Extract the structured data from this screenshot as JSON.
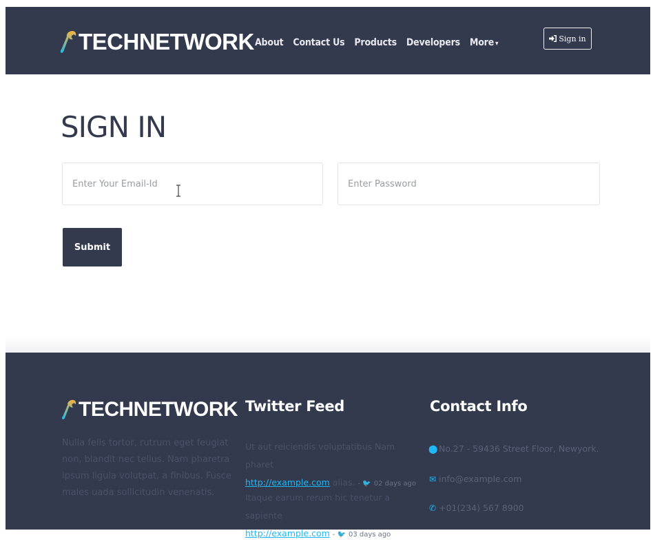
{
  "header": {
    "brand": "TECHNETWORK",
    "nav": [
      {
        "label": "About"
      },
      {
        "label": "Contact Us"
      },
      {
        "label": "Products"
      },
      {
        "label": "Developers"
      },
      {
        "label": "More"
      }
    ],
    "signin_label": "Sign in",
    "signin_icon": "sign-in-icon"
  },
  "main": {
    "title": "SIGN IN",
    "email_placeholder": "Enter Your Email-Id",
    "email_value": "",
    "password_placeholder": "Enter Password",
    "password_value": "",
    "submit_label": "Submit"
  },
  "footer": {
    "brand": "TECHNETWORK",
    "about_text": "Nulla felis tortor, rutrum eget feugiat non, blandit nec tellus. Nam pharetra ipsum ligula volutpat, a finibus. Fusce males uada sollicitudin venenatis.",
    "twitter_title": "Twitter Feed",
    "tweets": [
      {
        "text": "Ut aut reiciendis voluptatibus Nam pharet",
        "link": "http://example.com",
        "after_link": " alias.",
        "time": "02 days ago"
      },
      {
        "text": "Itaque earum rerum hic tenetur a sapiente",
        "link": "http://example.com",
        "after_link": "",
        "time": "03 days ago"
      }
    ],
    "contact_title": "Contact Info",
    "contact": {
      "address": "No.27 - 59436 Street Floor, Newyork.",
      "email": "info@example.com",
      "phone": "+01(234) 567 8900"
    }
  },
  "colors": {
    "navy": "#333a4e",
    "accent": "#20b7f5",
    "wrench_gradient": [
      "#f6b53b",
      "#25b9e6"
    ]
  }
}
